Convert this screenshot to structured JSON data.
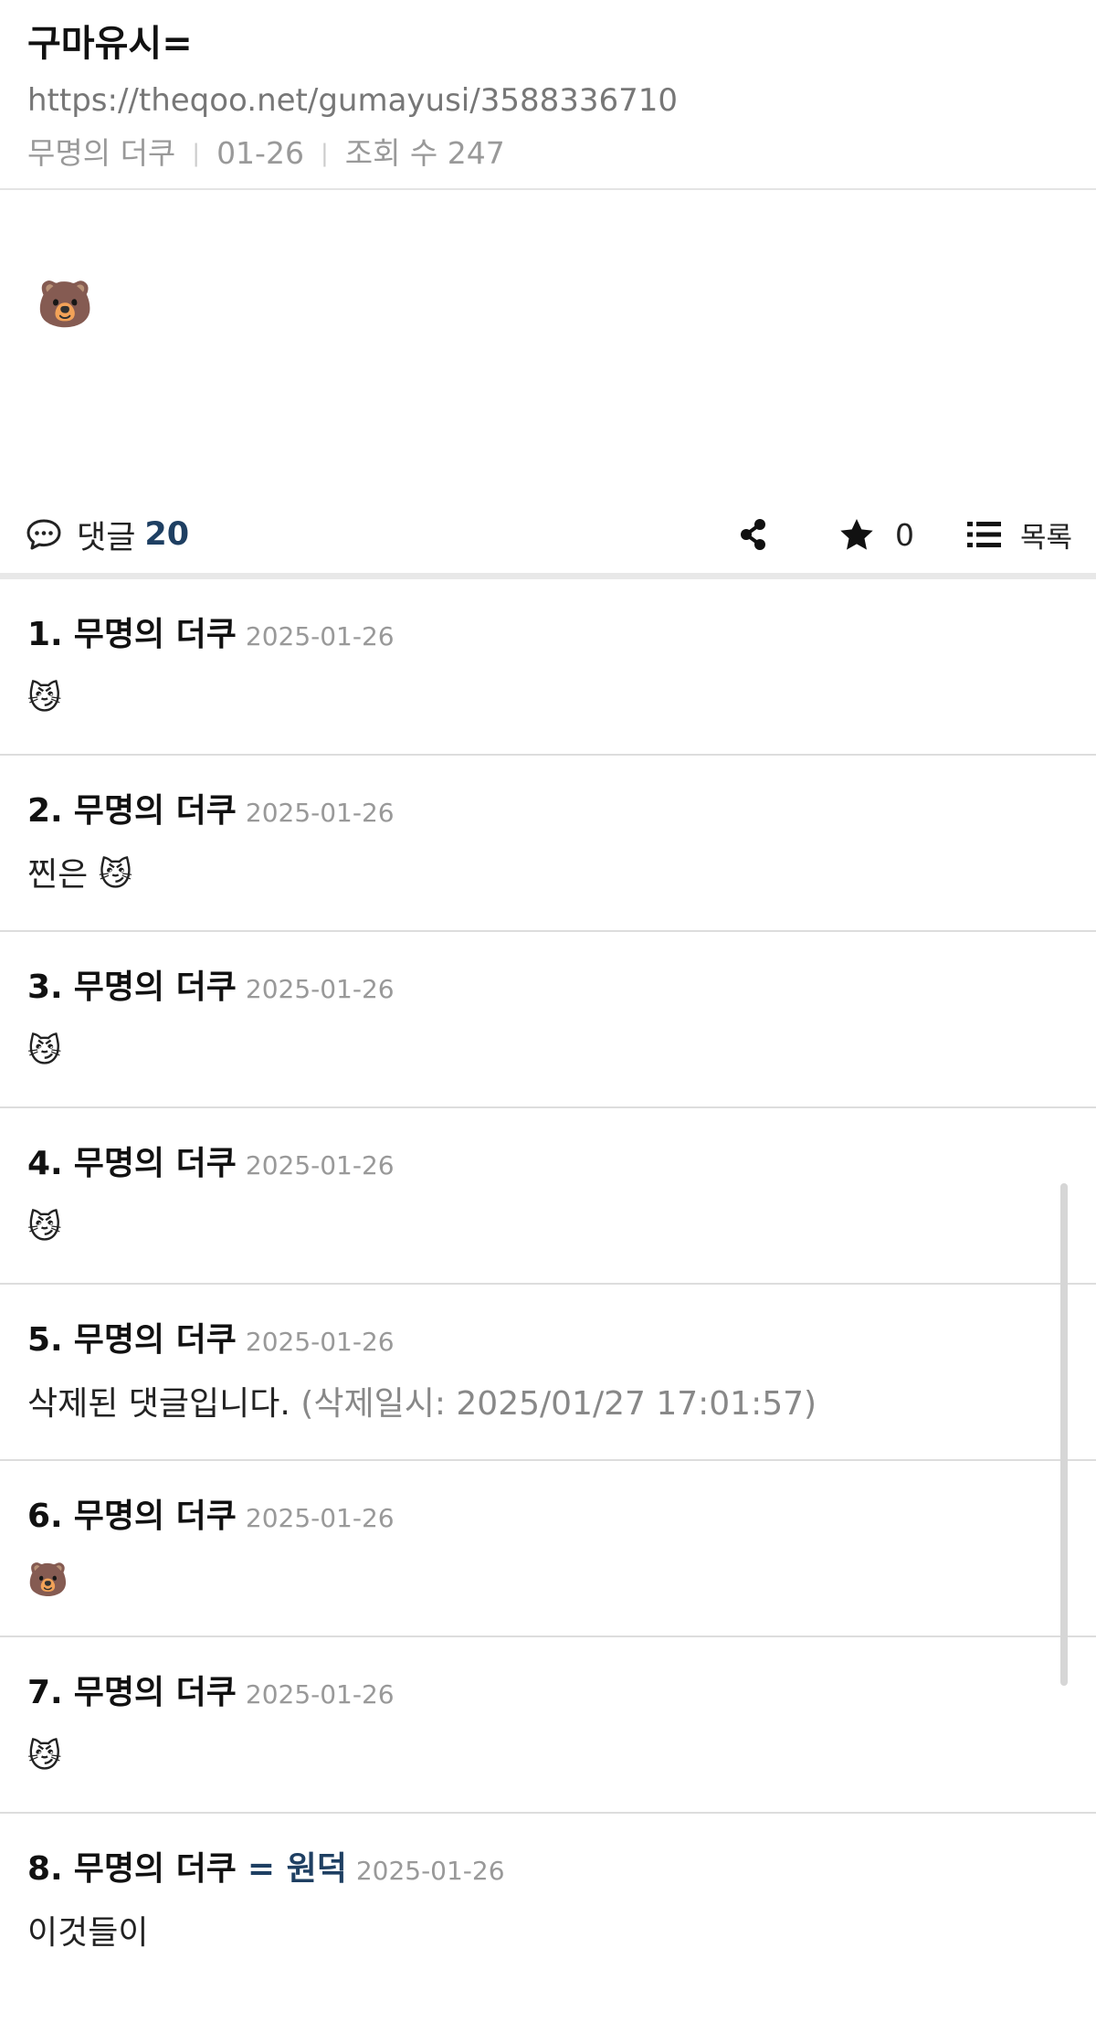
{
  "post": {
    "title": "구마유시=",
    "url": "https://theqoo.net/gumayusi/3588336710",
    "author": "무명의 더쿠",
    "date": "01-26",
    "views_label": "조회 수 247",
    "body_emoji": "🐻"
  },
  "actions": {
    "comments_label": "댓글",
    "comments_count": "20",
    "star_count": "0",
    "list_label": "목록"
  },
  "comments": [
    {
      "num": "1.",
      "author": "무명의 더쿠",
      "op": "",
      "date": "2025-01-26",
      "text": "😼",
      "deleted_time": ""
    },
    {
      "num": "2.",
      "author": "무명의 더쿠",
      "op": "",
      "date": "2025-01-26",
      "text": "찐은 😼",
      "deleted_time": ""
    },
    {
      "num": "3.",
      "author": "무명의 더쿠",
      "op": "",
      "date": "2025-01-26",
      "text": "😼",
      "deleted_time": ""
    },
    {
      "num": "4.",
      "author": "무명의 더쿠",
      "op": "",
      "date": "2025-01-26",
      "text": "😼",
      "deleted_time": ""
    },
    {
      "num": "5.",
      "author": "무명의 더쿠",
      "op": "",
      "date": "2025-01-26",
      "text": "삭제된 댓글입니다.",
      "deleted_time": " (삭제일시: 2025/01/27 17:01:57)"
    },
    {
      "num": "6.",
      "author": "무명의 더쿠",
      "op": "",
      "date": "2025-01-26",
      "text": "🐻",
      "deleted_time": ""
    },
    {
      "num": "7.",
      "author": "무명의 더쿠",
      "op": "",
      "date": "2025-01-26",
      "text": "😼",
      "deleted_time": ""
    },
    {
      "num": "8.",
      "author": "무명의 더쿠",
      "op": "= 원덕",
      "date": "2025-01-26",
      "text": "이것들이",
      "deleted_time": ""
    }
  ],
  "icons": {
    "comment": "speech-bubble-icon",
    "share": "share-icon",
    "star": "star-icon",
    "list": "list-icon"
  },
  "colors": {
    "accent": "#1e3f62",
    "muted": "#999999"
  }
}
